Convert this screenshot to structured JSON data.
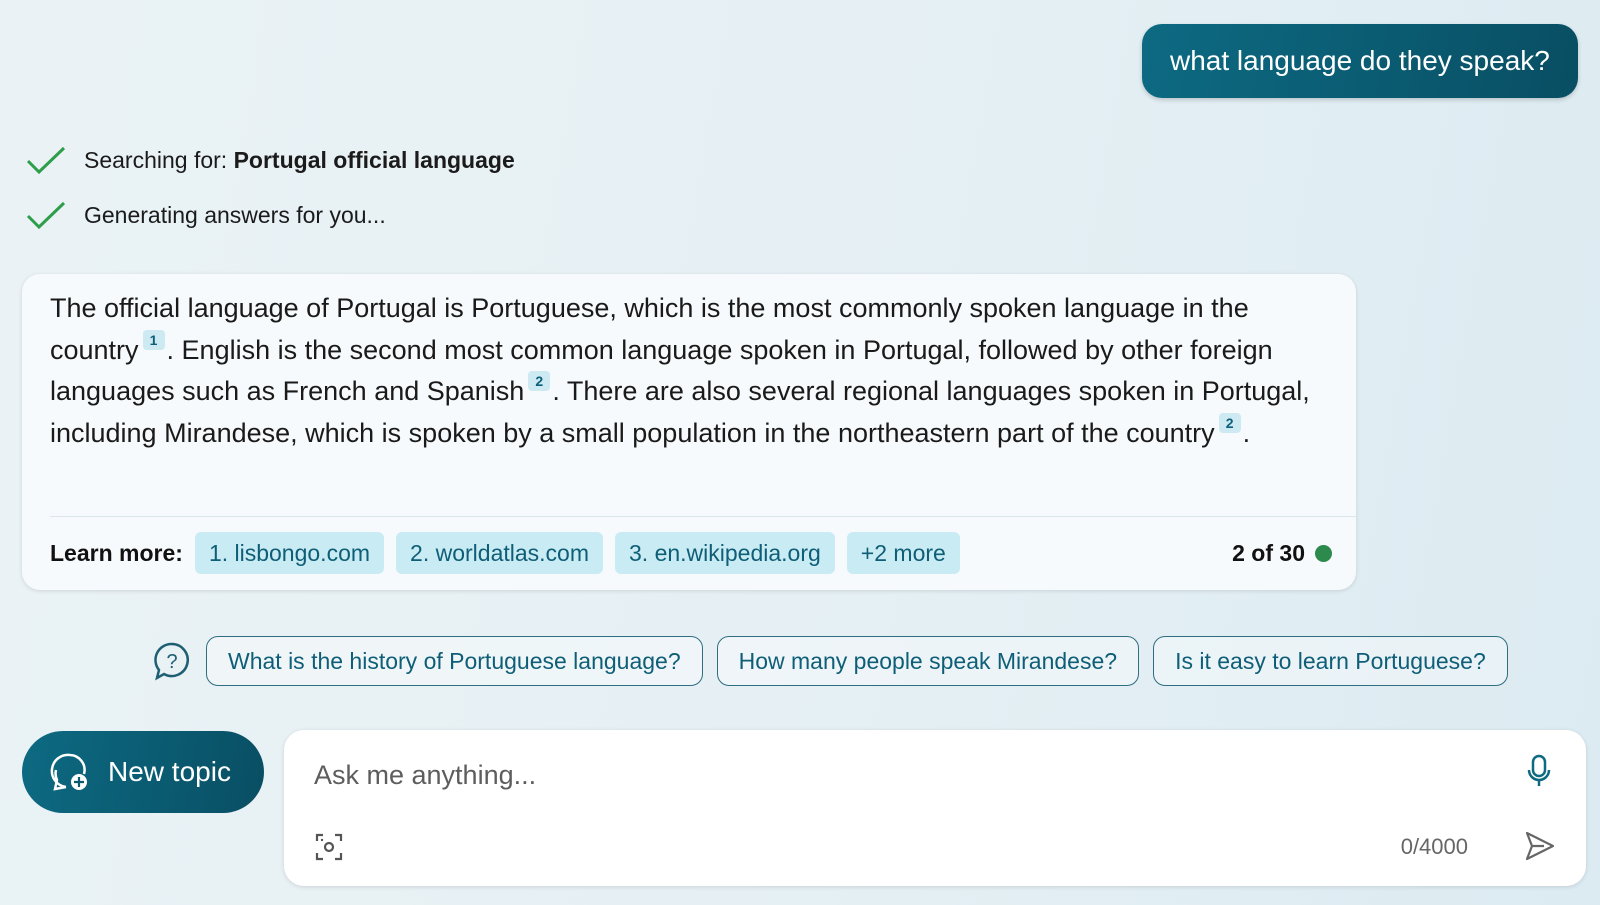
{
  "user_message": "what language do they speak?",
  "status": {
    "searching_prefix": "Searching for: ",
    "searching_query": "Portugal official language",
    "generating": "Generating answers for you..."
  },
  "answer": {
    "segments": {
      "s1": "The official language of Portugal is Portuguese, which is the most commonly spoken language in the country",
      "c1": "1",
      "s2": ". English is the second most common language spoken in Portugal, followed by other foreign languages such as French and Spanish",
      "c2": "2",
      "s3": ". There are also several regional languages spoken in Portugal, including Mirandese, which is spoken by a small population in the northeastern part of the country",
      "c3": "2",
      "s4": "."
    },
    "learn_more_label": "Learn more:",
    "sources": [
      "1. lisbongo.com",
      "2. worldatlas.com",
      "3. en.wikipedia.org",
      "+2 more"
    ],
    "page_count": "2 of 30",
    "status_color": "#2c8a4c"
  },
  "suggestions": [
    "What is the history of Portuguese language?",
    "How many people speak Mirandese?",
    "Is it easy to learn Portuguese?"
  ],
  "new_topic_label": "New topic",
  "input": {
    "placeholder": "Ask me anything...",
    "value": "",
    "char_count": "0/4000"
  },
  "icons": {
    "check": "check-icon",
    "question_bubble": "question-bubble-icon",
    "new_chat": "new-chat-icon",
    "mic": "microphone-icon",
    "visual_search": "camera-scan-icon",
    "send": "send-icon"
  },
  "colors": {
    "accent": "#0b5f7a",
    "chip_bg": "#c9ebf3",
    "check_green": "#2e9e4a"
  }
}
